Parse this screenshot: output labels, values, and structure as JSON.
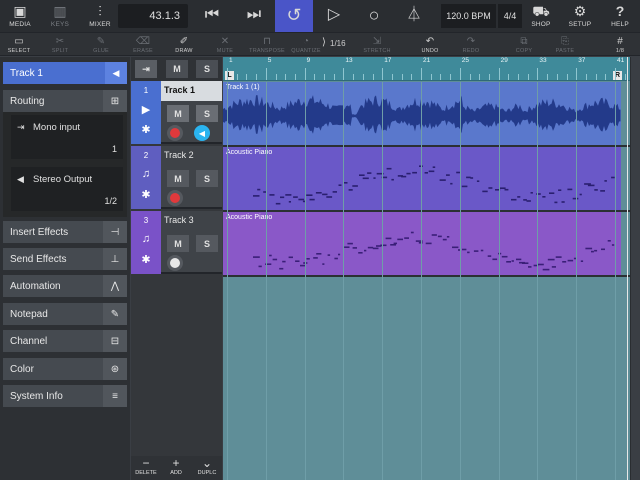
{
  "topbar": {
    "media": "MEDIA",
    "keys": "KEYS",
    "mixer": "MIXER",
    "position": "43.1.3",
    "tempo": "120.0 BPM",
    "signature": "4/4",
    "shop": "SHOP",
    "setup": "SETUP",
    "help": "HELP"
  },
  "toolbar": {
    "select": "SELECT",
    "split": "SPLIT",
    "glue": "GLUE",
    "erase": "ERASE",
    "draw": "DRAW",
    "mute": "MUTE",
    "transpose": "TRANSPOSE",
    "quantize": "QUANTIZE",
    "quantize_value": "1/16",
    "stretch": "STRETCH",
    "undo": "UNDO",
    "redo": "REDO",
    "copy": "COPY",
    "paste": "PASTE",
    "snap": "1/8"
  },
  "inspector": {
    "track_name": "Track 1",
    "routing": "Routing",
    "input_name": "Mono input",
    "input_value": "1",
    "output_name": "Stereo Output",
    "output_value": "1/2",
    "sections": [
      "Insert Effects",
      "Send Effects",
      "Automation",
      "Notepad",
      "Channel",
      "Color",
      "System Info"
    ]
  },
  "tracks": [
    {
      "number": "1",
      "name": "Track 1",
      "event": "Track 1 (1)",
      "mute": "M",
      "solo": "S"
    },
    {
      "number": "2",
      "name": "Track 2",
      "event": "Acoustic Piano",
      "mute": "M",
      "solo": "S"
    },
    {
      "number": "3",
      "name": "Track 3",
      "event": "Acoustic Piano",
      "mute": "M",
      "solo": "S"
    }
  ],
  "tracklist_header": {
    "mute": "M",
    "solo": "S"
  },
  "bottom": {
    "delete": "DELETE",
    "add": "ADD",
    "duplicate": "DUPLC"
  },
  "ruler": {
    "ticks": [
      "1",
      "5",
      "9",
      "13",
      "17",
      "21",
      "25",
      "29",
      "33",
      "37",
      "41"
    ],
    "left_locator": "L",
    "right_locator": "R"
  }
}
